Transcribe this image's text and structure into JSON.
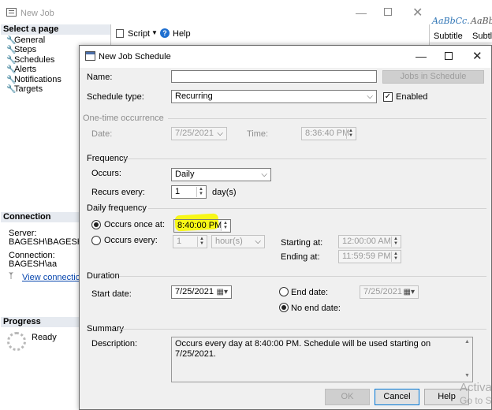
{
  "background_window": {
    "title": "New Job",
    "select_page_header": "Select a page",
    "pages": [
      "General",
      "Steps",
      "Schedules",
      "Alerts",
      "Notifications",
      "Targets"
    ],
    "toolbar": {
      "script_label": "Script",
      "help_label": "Help"
    },
    "connection_header": "Connection",
    "server_label": "Server:",
    "server_value": "BAGESH\\BAGESHDB",
    "connection_label": "Connection:",
    "connection_value": "BAGESH\\aa",
    "view_connection_link": "View connection pr",
    "progress_header": "Progress",
    "progress_status": "Ready",
    "styles": {
      "style1_sample": "AaBbCc.",
      "style1_name": "Subtitle",
      "style2_sample": "AaBb",
      "style2_name": "Subtle"
    }
  },
  "dialog": {
    "title": "New Job Schedule",
    "name_label": "Name:",
    "name_value": "",
    "jobs_in_schedule_button": "Jobs in Schedule",
    "schedule_type_label": "Schedule type:",
    "schedule_type_value": "Recurring",
    "enabled_label": "Enabled",
    "enabled": true,
    "one_time": {
      "header": "One-time occurrence",
      "date_label": "Date:",
      "date_value": "7/25/2021",
      "time_label": "Time:",
      "time_value": "8:36:40 PM"
    },
    "frequency": {
      "header": "Frequency",
      "occurs_label": "Occurs:",
      "occurs_value": "Daily",
      "recurs_label": "Recurs every:",
      "recurs_value": "1",
      "recurs_unit": "day(s)"
    },
    "daily_frequency": {
      "header": "Daily frequency",
      "once_label": "Occurs once at:",
      "once_value": "8:40:00 PM",
      "every_label": "Occurs every:",
      "every_value": "1",
      "every_unit": "hour(s)",
      "starting_label": "Starting at:",
      "starting_value": "12:00:00 AM",
      "ending_label": "Ending at:",
      "ending_value": "11:59:59 PM",
      "highlight_color": "#f7f700"
    },
    "duration": {
      "header": "Duration",
      "start_label": "Start date:",
      "start_value": "7/25/2021",
      "end_label": "End date:",
      "end_value": "7/25/2021",
      "no_end_label": "No end date:"
    },
    "summary": {
      "header": "Summary",
      "description_label": "Description:",
      "description_value": "Occurs every day at 8:40:00 PM. Schedule will be used starting on 7/25/2021."
    },
    "buttons": {
      "ok": "OK",
      "cancel": "Cancel",
      "help": "Help"
    }
  },
  "watermark": {
    "line1": "Activa",
    "line2": "Go to S"
  },
  "icons": [
    "new-job-icon",
    "wrench-icon",
    "script-icon",
    "help-icon",
    "calendar-icon",
    "connection-icon",
    "spinner-icon"
  ]
}
